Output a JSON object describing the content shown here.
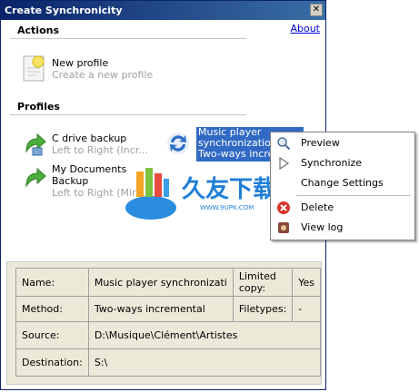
{
  "window": {
    "title": "Create Synchronicity",
    "close_glyph": "✕"
  },
  "actions": {
    "heading": "Actions",
    "about_label": "About",
    "new_profile": {
      "title": "New profile",
      "subtitle": "Create a new profile"
    }
  },
  "profiles": {
    "heading": "Profiles",
    "items": [
      {
        "title": "C drive backup",
        "subtitle": "Left to Right (Incr..."
      },
      {
        "title": "My Documents",
        "title2": "Backup",
        "subtitle": "Left to Right (Mirr..."
      },
      {
        "title": "Music player",
        "title2": "synchronizatio",
        "subtitle": "Two-ways incre"
      }
    ]
  },
  "context_menu": {
    "items": [
      {
        "label": "Preview",
        "icon": "magnifier-icon"
      },
      {
        "label": "Synchronize",
        "icon": "play-icon"
      },
      {
        "label": "Change Settings",
        "icon": ""
      },
      {
        "label": "Delete",
        "icon": "delete-icon"
      },
      {
        "label": "View log",
        "icon": "log-icon"
      }
    ]
  },
  "details": {
    "name_label": "Name:",
    "name_value": "Music player synchronizati",
    "limited_label": "Limited copy:",
    "limited_value": "Yes",
    "method_label": "Method:",
    "method_value": "Two-ways incremental",
    "filetypes_label": "Filetypes:",
    "filetypes_value": "-",
    "source_label": "Source:",
    "source_value": "D:\\Musique\\Clément\\Artistes",
    "destination_label": "Destination:",
    "destination_value": "S:\\"
  },
  "watermark": {
    "text": "久友下载",
    "url": "WWW.9UPK.COM"
  },
  "colors": {
    "title_bar": "#0a246a",
    "selection": "#316ac5",
    "link": "#0000cc"
  }
}
